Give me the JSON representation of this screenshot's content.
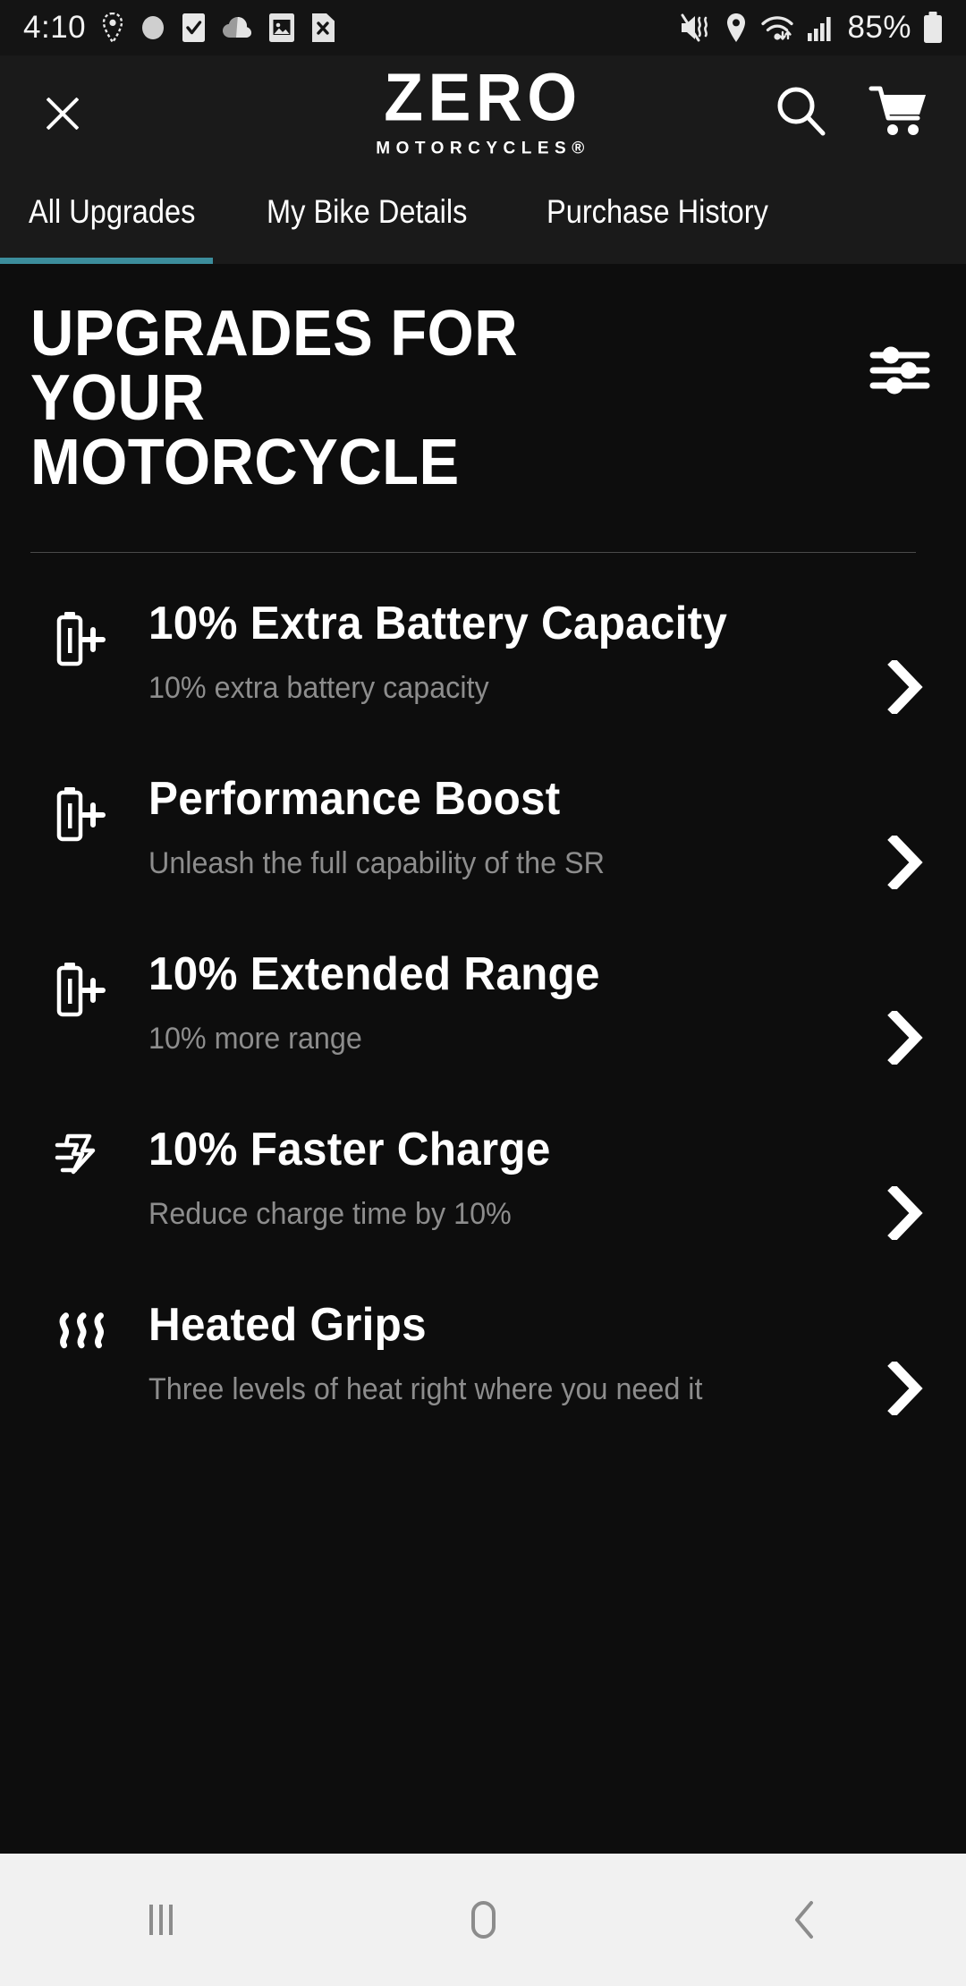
{
  "status_bar": {
    "time": "4:10",
    "battery_percent": "85%",
    "left_icons": [
      "location-pin-outline-icon",
      "circle-dot-icon",
      "checkbox-checked-icon",
      "cloud-icon",
      "photo-icon",
      "sim-card-x-icon"
    ],
    "right_icons": [
      "mute-vibrate-icon",
      "location-pin-filled-icon",
      "wifi-icon",
      "cellular-signal-icon",
      "battery-icon"
    ]
  },
  "header": {
    "close_label": "close-icon",
    "brand_primary": "ZERO",
    "brand_secondary": "MOTORCYCLES®",
    "search_label": "search-icon",
    "cart_label": "cart-icon"
  },
  "tabs": {
    "active_index": 0,
    "active_color": "#3c8d9c",
    "items": [
      {
        "label": "All Upgrades"
      },
      {
        "label": "My Bike Details"
      },
      {
        "label": "Purchase History"
      }
    ]
  },
  "page": {
    "title": "UPGRADES FOR YOUR MOTORCYCLE",
    "filter_label": "filter-sliders-icon"
  },
  "upgrades": [
    {
      "icon": "battery-plus-icon",
      "title": "10% Extra Battery Capacity",
      "description": "10% extra battery capacity",
      "chevron": "chevron-right-icon"
    },
    {
      "icon": "battery-plus-icon",
      "title": "Performance Boost",
      "description": "Unleash the full capability of the SR",
      "chevron": "chevron-right-icon"
    },
    {
      "icon": "battery-plus-icon",
      "title": "10% Extended Range",
      "description": "10% more range",
      "chevron": "chevron-right-icon"
    },
    {
      "icon": "fast-charge-bolt-icon",
      "title": "10% Faster Charge",
      "description": "Reduce charge time by 10%",
      "chevron": "chevron-right-icon"
    },
    {
      "icon": "heat-waves-icon",
      "title": "Heated Grips",
      "description": "Three levels of heat right where you need it",
      "chevron": "chevron-right-icon"
    }
  ],
  "bottom_nav": {
    "recents_label": "recents-icon",
    "home_label": "home-icon",
    "back_label": "back-icon"
  },
  "colors": {
    "background": "#0d0d0d",
    "surface": "#1a1a1a",
    "accent": "#3c8d9c",
    "text_primary": "#ffffff",
    "text_secondary": "#8d8d8d",
    "nav_bar": "#f1f1f1"
  }
}
